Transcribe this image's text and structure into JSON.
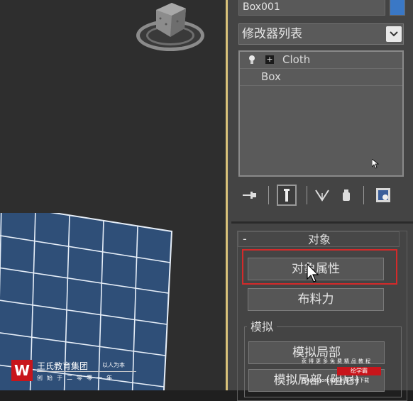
{
  "viewport": {},
  "panel": {
    "object_name": "Box001",
    "object_color": "#3a78c6",
    "modifier_list": "修改器列表",
    "stack": [
      {
        "label": "Cloth",
        "icon": "lightbulb-icon"
      },
      {
        "label": "Box"
      }
    ],
    "toolbar": [
      {
        "icon": "pin-stack-icon"
      },
      {
        "icon": "show-end-result-icon"
      },
      {
        "icon": "make-unique-icon"
      },
      {
        "icon": "remove-modifier-icon"
      },
      {
        "icon": "configure-modifier-sets-icon"
      }
    ]
  },
  "object_rollout": {
    "collapse": "-",
    "title": "对象",
    "object_properties_button": "对象属性",
    "cloth_forces_button": "布料力"
  },
  "simulation": {
    "group_label": "模拟",
    "local_sim_button": "模拟局部",
    "local_damped_button": "模拟局部 (阻尼)"
  },
  "watermark": {
    "logo_letter": "W",
    "company": "王氏教育集团",
    "slogan": "以人为本",
    "sub": "创始于二零零一年",
    "ad_line1": "获得更多免费精品教程",
    "ad_brand": "绘学霸",
    "ad_line3": "在AppStore或应用宝搜索下载"
  },
  "colors": {
    "highlight": "#d42a2a",
    "accent_border": "#d9c27a",
    "plane_fill": "#2f4f78",
    "plane_grid": "#e6eef8"
  }
}
